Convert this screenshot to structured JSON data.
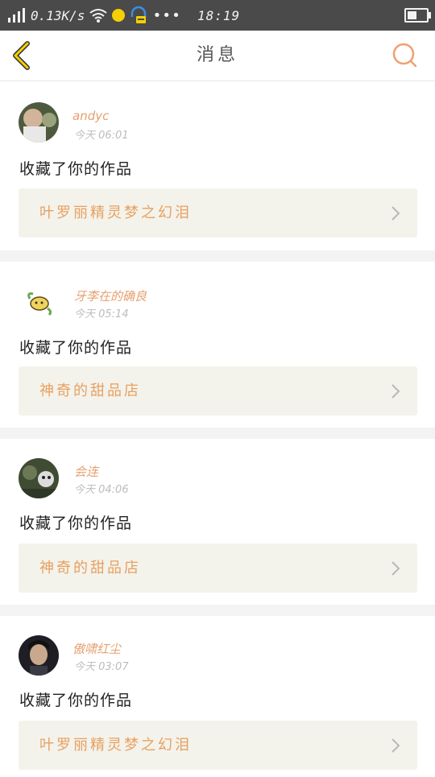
{
  "status_bar": {
    "network_speed": "0.13K/s",
    "time": "18:19",
    "icons": [
      "signal-icon",
      "wifi-icon",
      "notification-dot-icon",
      "headset-icon",
      "more-icon",
      "battery-icon"
    ],
    "battery_level": 0.5
  },
  "header": {
    "title": "消息",
    "back_icon": "back-chevron-icon",
    "search_icon": "search-icon",
    "accent_color": "#e8a060"
  },
  "messages": [
    {
      "username": "andyc",
      "time": "今天 06:01",
      "action": "收藏了你的作品",
      "work_title": "叶罗丽精灵梦之幻泪"
    },
    {
      "username": "牙李在的确良",
      "time": "今天 05:14",
      "action": "收藏了你的作品",
      "work_title": "神奇的甜品店"
    },
    {
      "username": "会连",
      "time": "今天 04:06",
      "action": "收藏了你的作品",
      "work_title": "神奇的甜品店"
    },
    {
      "username": "傲啸红尘",
      "time": "今天 03:07",
      "action": "收藏了你的作品",
      "work_title": "叶罗丽精灵梦之幻泪"
    }
  ]
}
